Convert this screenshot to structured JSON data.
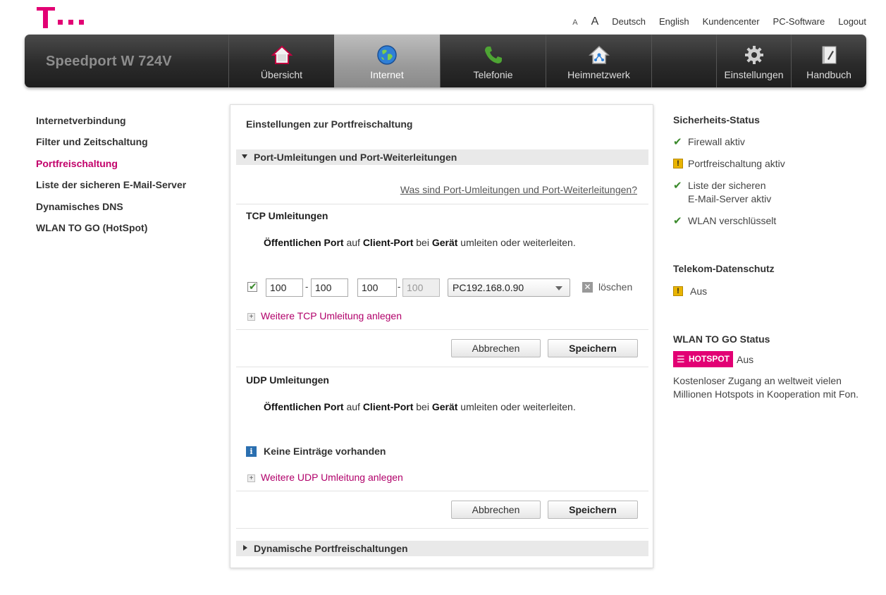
{
  "toplinks": {
    "font_small": "A",
    "font_large": "A",
    "deutsch": "Deutsch",
    "english": "English",
    "kundencenter": "Kundencenter",
    "pc_software": "PC-Software",
    "logout": "Logout"
  },
  "brand": "Speedport W 724V",
  "nav": {
    "uebersicht": "Übersicht",
    "internet": "Internet",
    "telefonie": "Telefonie",
    "heimnetzwerk": "Heimnetzwerk",
    "einstellungen": "Einstellungen",
    "handbuch": "Handbuch"
  },
  "leftmenu": [
    "Internetverbindung",
    "Filter und Zeitschaltung",
    "Portfreischaltung",
    "Liste der sicheren E-Mail-Server",
    "Dynamisches DNS",
    "WLAN TO GO (HotSpot)"
  ],
  "panel": {
    "title": "Einstellungen zur Portfreischaltung",
    "section1": "Port-Umleitungen und Port-Weiterleitungen",
    "helplink": "Was sind Port-Umleitungen und Port-Weiterleitungen?",
    "tcp": {
      "title": "TCP Umleitungen",
      "desc_a": "Öffentlichen Port",
      "desc_b": " auf ",
      "desc_c": "Client-Port",
      "desc_d": " bei ",
      "desc_e": "Gerät",
      "desc_f": " umleiten oder weiterleiten.",
      "pub_from": "100",
      "pub_to": "100",
      "client_from": "100",
      "client_to": "100",
      "device": "PC192.168.0.90",
      "delete": "löschen",
      "add": "Weitere TCP Umleitung anlegen",
      "cancel": "Abbrechen",
      "save": "Speichern"
    },
    "udp": {
      "title": "UDP Umleitungen",
      "desc_a": "Öffentlichen Port",
      "desc_b": " auf ",
      "desc_c": "Client-Port",
      "desc_d": " bei ",
      "desc_e": "Gerät",
      "desc_f": " umleiten oder weiterleiten.",
      "empty": "Keine Einträge vorhanden",
      "add": "Weitere UDP Umleitung anlegen",
      "cancel": "Abbrechen",
      "save": "Speichern"
    },
    "section2": "Dynamische Portfreischaltungen"
  },
  "right": {
    "security_title": "Sicherheits-Status",
    "firewall": "Firewall aktiv",
    "portfreischaltung": "Portfreischaltung aktiv",
    "mail_line1": "Liste der sicheren",
    "mail_line2": "E-Mail-Server aktiv",
    "wlan": "WLAN verschlüsselt",
    "privacy_title": "Telekom-Datenschutz",
    "privacy_status": "Aus",
    "wlan_togo_title": "WLAN TO GO Status",
    "hotspot_badge": "HOTSPOT",
    "hotspot_status": "Aus",
    "hotspot_text1": "Kostenloser Zugang an weltweit vielen",
    "hotspot_text2": "Millionen Hotspots in Kooperation mit Fon."
  },
  "colors": {
    "magenta": "#e20074",
    "link_magenta": "#b1006a",
    "check_green": "#3b8a2c"
  }
}
